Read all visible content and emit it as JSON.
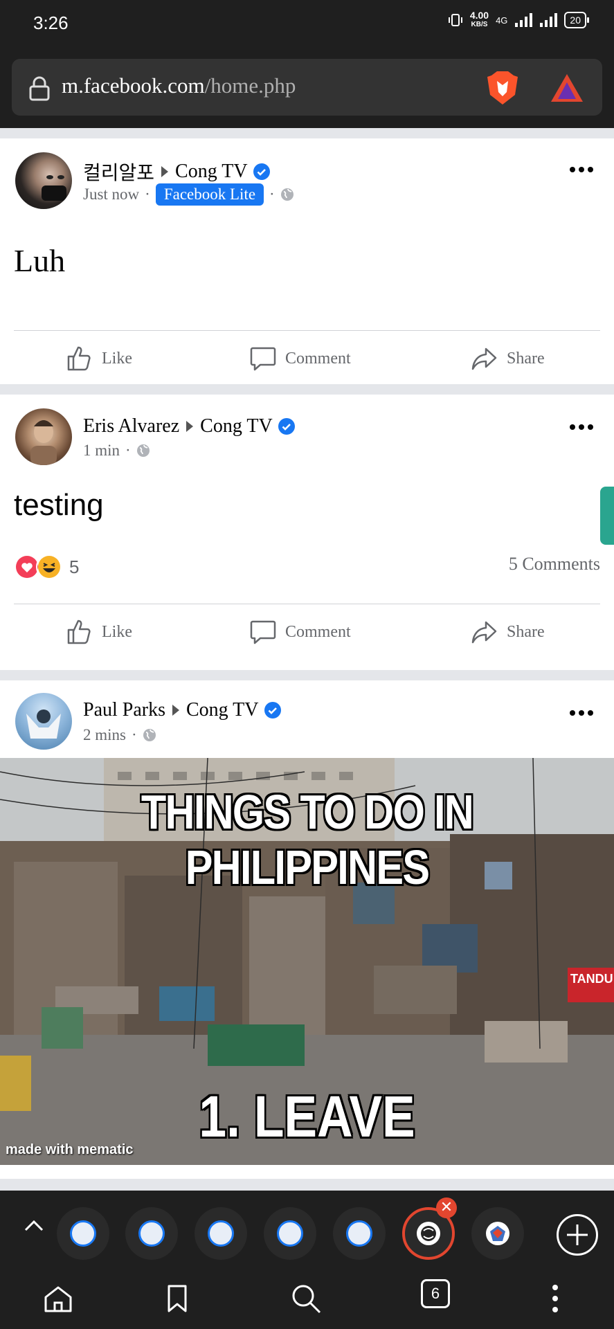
{
  "status_bar": {
    "time": "3:26",
    "net_speed_value": "4.00",
    "net_speed_unit": "KB/S",
    "network": "4G",
    "battery": "20"
  },
  "browser": {
    "url_host": "m.facebook.com",
    "url_path": "/home.php"
  },
  "posts": [
    {
      "author": "컬리알포",
      "target": "Cong TV",
      "time": "Just now",
      "badge": "Facebook Lite",
      "text": "Luh",
      "actions": {
        "like": "Like",
        "comment": "Comment",
        "share": "Share"
      }
    },
    {
      "author": "Eris Alvarez",
      "target": "Cong TV",
      "time": "1 min",
      "text": "testing",
      "reaction_count": "5",
      "comments": "5 Comments",
      "actions": {
        "like": "Like",
        "comment": "Comment",
        "share": "Share"
      }
    },
    {
      "author": "Paul Parks",
      "target": "Cong TV",
      "time": "2 mins",
      "meme_top": "THINGS TO DO IN PHILIPPINES",
      "meme_bottom": "1. LEAVE",
      "meme_watermark": "made with mematic",
      "sign_text": "TANDU"
    }
  ],
  "tabs": {
    "count": "6"
  },
  "colors": {
    "facebook_blue": "#1877f2",
    "brave_orange": "#e2462f",
    "chrome_dark": "#1f1f1f"
  }
}
